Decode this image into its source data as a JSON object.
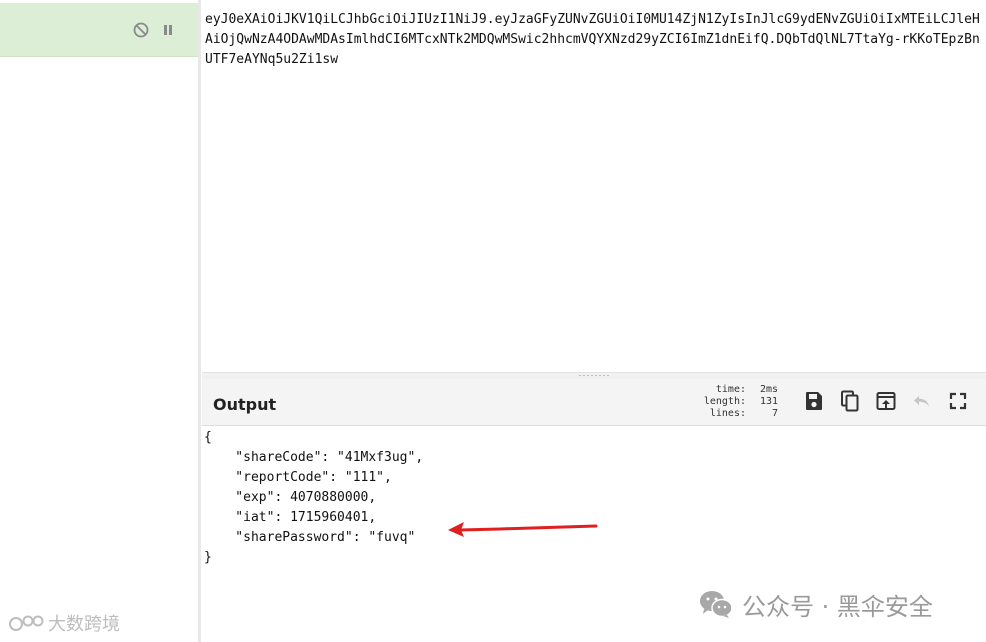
{
  "operation": {
    "disable_icon": "disable-icon",
    "pause_icon": "pause-icon",
    "highlight_color": "#dcefd6"
  },
  "input": {
    "text": "eyJ0eXAiOiJKV1QiLCJhbGciOiJIUzI1NiJ9.eyJzaGFyZUNvZGUiOiI0MU14ZjN1ZyIsInJlcG9ydENvZGUiOiIxMTEiLCJleHAiOjQwNzA4ODAwMDAsImlhdCI6MTcxNTk2MDQwMSwic2hhcmVQYXNzd29yZCI6ImZ1dnEifQ.DQbTdQlNL7TtaYg-rKKoTEpzBnUTF7eAYNq5u2Zi1sw"
  },
  "output": {
    "title": "Output",
    "stats": [
      {
        "label": "time:",
        "value": "2ms"
      },
      {
        "label": "length:",
        "value": "131"
      },
      {
        "label": "lines:",
        "value": "7"
      }
    ],
    "toolbar": [
      "save-icon",
      "copy-icon",
      "replace-input-icon",
      "undo-icon",
      "fullscreen-icon"
    ],
    "lines": [
      "{",
      "    \"shareCode\": \"41Mxf3ug\",",
      "    \"reportCode\": \"111\",",
      "    \"exp\": 4070880000,",
      "    \"iat\": 1715960401,",
      "    \"sharePassword\": \"fuvq\"",
      "}"
    ]
  },
  "annotation": {
    "arrow_color": "#e02020"
  },
  "watermarks": {
    "right": "公众号 · 黑伞安全",
    "left": "大数跨境"
  }
}
